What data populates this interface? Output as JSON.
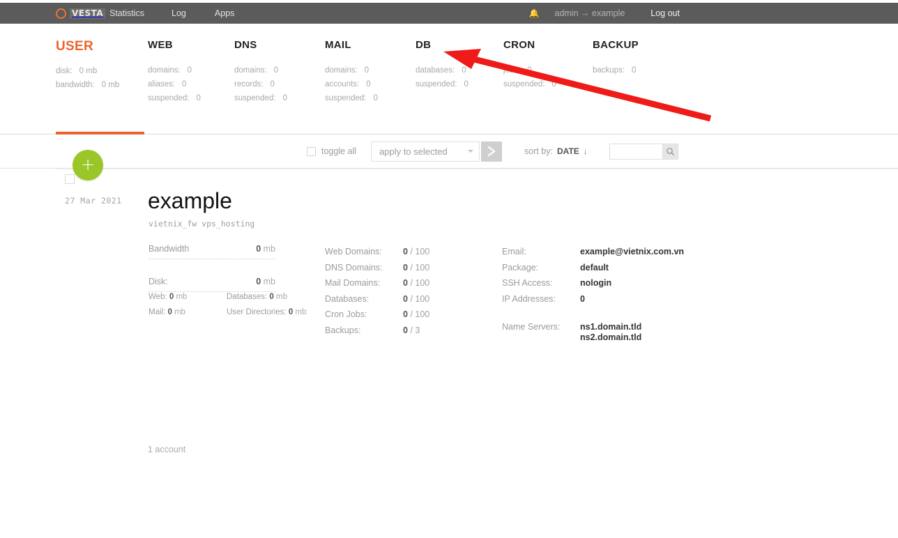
{
  "topbar": {
    "logo_icon": "vesta-ring-icon",
    "logo_text": "VESTA",
    "nav": [
      {
        "label": "Statistics"
      },
      {
        "label": "Log"
      },
      {
        "label": "Apps"
      }
    ],
    "bell_icon": "bell-icon",
    "user_switch": "admin → example",
    "logout_label": "Log out"
  },
  "stats": [
    {
      "title": "USER",
      "active": true,
      "rows": [
        {
          "key": "disk:",
          "value": "0 mb"
        },
        {
          "key": "bandwidth:",
          "value": "0 mb"
        }
      ]
    },
    {
      "title": "WEB",
      "active": false,
      "rows": [
        {
          "key": "domains:",
          "value": "0"
        },
        {
          "key": "aliases:",
          "value": "0"
        },
        {
          "key": "suspended:",
          "value": "0"
        }
      ]
    },
    {
      "title": "DNS",
      "active": false,
      "rows": [
        {
          "key": "domains:",
          "value": "0"
        },
        {
          "key": "records:",
          "value": "0"
        },
        {
          "key": "suspended:",
          "value": "0"
        }
      ]
    },
    {
      "title": "MAIL",
      "active": false,
      "rows": [
        {
          "key": "domains:",
          "value": "0"
        },
        {
          "key": "accounts:",
          "value": "0"
        },
        {
          "key": "suspended:",
          "value": "0"
        }
      ]
    },
    {
      "title": "DB",
      "active": false,
      "rows": [
        {
          "key": "databases:",
          "value": "0"
        },
        {
          "key": "suspended:",
          "value": "0"
        }
      ]
    },
    {
      "title": "CRON",
      "active": false,
      "rows": [
        {
          "key": "jobs:",
          "value": "0"
        },
        {
          "key": "suspended:",
          "value": "0"
        }
      ]
    },
    {
      "title": "BACKUP",
      "active": false,
      "rows": [
        {
          "key": "backups:",
          "value": "0"
        }
      ]
    }
  ],
  "toolbar": {
    "toggle_all_label": "toggle all",
    "apply_select_value": "apply to selected",
    "apply_select_icon": "chevron-down-icon",
    "go_button_icon": "chevron-right-icon",
    "sort_by_label": "sort by:",
    "sort_by_value": "DATE",
    "sort_by_direction": "↓",
    "search_value": "",
    "search_placeholder": "",
    "search_icon": "search-icon"
  },
  "list": {
    "add_button_icon": "plus-icon",
    "add_button_label": "+",
    "footer_count": "1 account"
  },
  "record": {
    "date": "27 Mar 2021",
    "name": "example",
    "subtitle": "vietnix_fw vps_hosting",
    "usage": {
      "bandwidth_label": "Bandwidth",
      "bandwidth_value": "0",
      "bandwidth_unit": "mb",
      "disk_label": "Disk:",
      "disk_value": "0",
      "disk_unit": "mb",
      "breakdown": [
        {
          "label": "Web:",
          "value": "0",
          "unit": "mb"
        },
        {
          "label": "Databases:",
          "value": "0",
          "unit": "mb"
        },
        {
          "label": "Mail:",
          "value": "0",
          "unit": "mb"
        },
        {
          "label": "User Directories:",
          "value": "0",
          "unit": "mb"
        }
      ]
    },
    "counters": [
      {
        "key": "Web Domains:",
        "value": "0",
        "limit": "/ 100"
      },
      {
        "key": "DNS Domains:",
        "value": "0",
        "limit": "/ 100"
      },
      {
        "key": "Mail Domains:",
        "value": "0",
        "limit": "/ 100"
      },
      {
        "key": "Databases:",
        "value": "0",
        "limit": "/ 100"
      },
      {
        "key": "Cron Jobs:",
        "value": "0",
        "limit": "/ 100"
      },
      {
        "key": "Backups:",
        "value": "0",
        "limit": "/ 3"
      }
    ],
    "info": [
      {
        "key": "Email:",
        "value": "example@vietnix.com.vn"
      },
      {
        "key": "Package:",
        "value": "default"
      },
      {
        "key": "SSH Access:",
        "value": "nologin"
      },
      {
        "key": "IP Addresses:",
        "value": "0"
      }
    ],
    "name_servers": {
      "key": "Name Servers:",
      "values": [
        "ns1.domain.tld",
        "ns2.domain.tld"
      ]
    }
  },
  "annotation": {
    "arrow_color": "#ee1b19",
    "arrow_target": "DB"
  },
  "colors": {
    "brand_orange": "#ef632a",
    "topbar_gray": "#5b5b5b",
    "add_green": "#9ac727"
  }
}
